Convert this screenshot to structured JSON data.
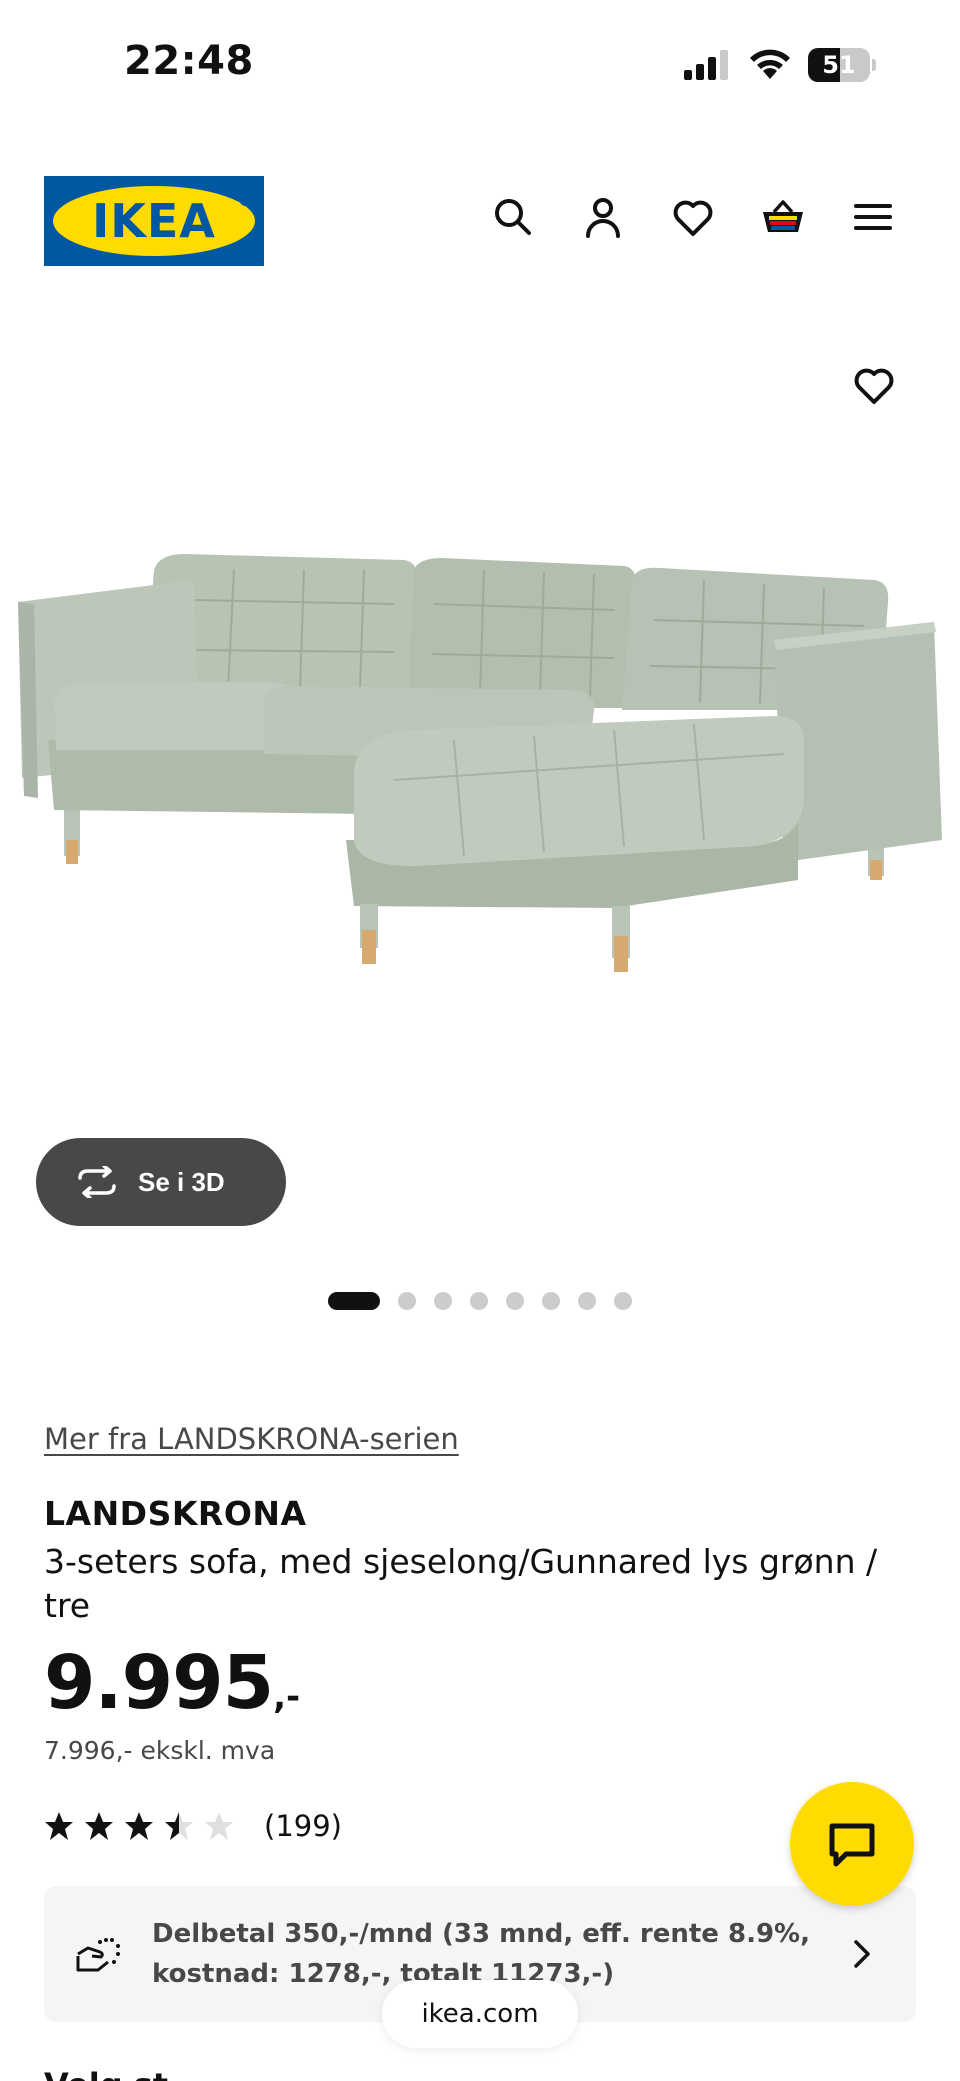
{
  "status_bar": {
    "time": "22:48",
    "battery_level": "51",
    "battery_percent": 51
  },
  "header": {
    "logo_text": "IKEA",
    "icons": [
      "search-icon",
      "account-icon",
      "heart-icon",
      "basket-icon",
      "menu-icon"
    ]
  },
  "gallery": {
    "view_3d_label": "Se i 3D",
    "dot_count": 8,
    "active_dot": 0
  },
  "product": {
    "series_link": "Mer fra LANDSKRONA-serien",
    "name": "LANDSKRONA",
    "description": "3-seters sofa, med sjeselong/Gunnared lys grønn / tre",
    "price_main": "9.995",
    "price_suffix": ",-",
    "price_ex_vat": "7.996,- ekskl. mva",
    "rating_value": 3.5,
    "rating_max": 5,
    "rating_count": "(199)"
  },
  "finance": {
    "text": "Delbetal 350,-/mnd (33 mnd, eff. rente 8.9%, kostnad: 1278,-, totalt 11273,-)"
  },
  "browser": {
    "url": "ikea.com"
  },
  "bottom_partial_text": "Velg st...",
  "colors": {
    "ikea_blue": "#0058a3",
    "ikea_yellow": "#ffdb00",
    "sofa_green": "#b8c4b5",
    "wood": "#d6a96e",
    "dark_button": "#484848"
  }
}
